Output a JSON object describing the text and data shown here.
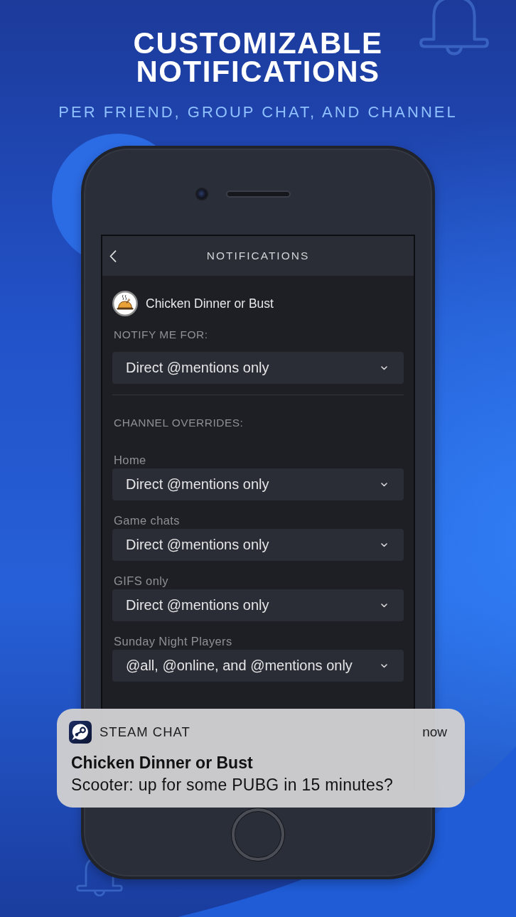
{
  "header": {
    "title": "CUSTOMIZABLE NOTIFICATIONS",
    "subtitle": "PER FRIEND, GROUP CHAT, AND CHANNEL"
  },
  "screen": {
    "title": "NOTIFICATIONS",
    "group": {
      "name": "Chicken Dinner or Bust"
    },
    "notify": {
      "label": "NOTIFY ME FOR:",
      "value": "Direct @mentions only"
    },
    "overrides_label": "CHANNEL OVERRIDES:",
    "overrides": [
      {
        "channel": "Home",
        "value": "Direct @mentions only"
      },
      {
        "channel": "Game chats",
        "value": "Direct @mentions only"
      },
      {
        "channel": "GIFS only",
        "value": "Direct @mentions only"
      },
      {
        "channel": "Sunday Night Players",
        "value": "@all, @online, and @mentions only"
      }
    ]
  },
  "notification": {
    "app": "STEAM CHAT",
    "time": "now",
    "title": "Chicken Dinner or Bust",
    "body": "Scooter: up for some PUBG in 15 minutes?"
  }
}
